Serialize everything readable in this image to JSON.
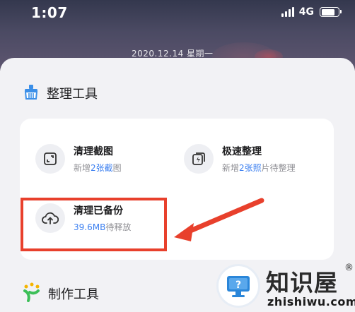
{
  "status_bar": {
    "time": "1:07",
    "network": "4G"
  },
  "wallpaper": {
    "date": "2020.12.14  星期一"
  },
  "organize_section": {
    "title": "整理工具",
    "icon": "broom-icon"
  },
  "tools": [
    {
      "title": "清理截图",
      "sub_prefix": "新增",
      "sub_highlight": "2张截",
      "sub_suffix": "图",
      "icon": "screenshot-icon"
    },
    {
      "title": "极速整理",
      "sub_prefix": "新增",
      "sub_highlight": "2张照",
      "sub_suffix": "片待整理",
      "icon": "flash-icon"
    },
    {
      "title": "清理已备份",
      "sub_prefix": "",
      "sub_highlight": "39.6MB",
      "sub_suffix": "待释放",
      "icon": "cloud-upload-icon"
    }
  ],
  "make_section": {
    "title": "制作工具",
    "icon": "sparkle-icon"
  },
  "watermark": {
    "name": "知识屋",
    "reg": "®",
    "domain": "zhishiwu.com"
  },
  "colors": {
    "accent": "#3b7ff0",
    "annotation": "#e8402c",
    "sheet_bg": "#f2f2f5"
  }
}
